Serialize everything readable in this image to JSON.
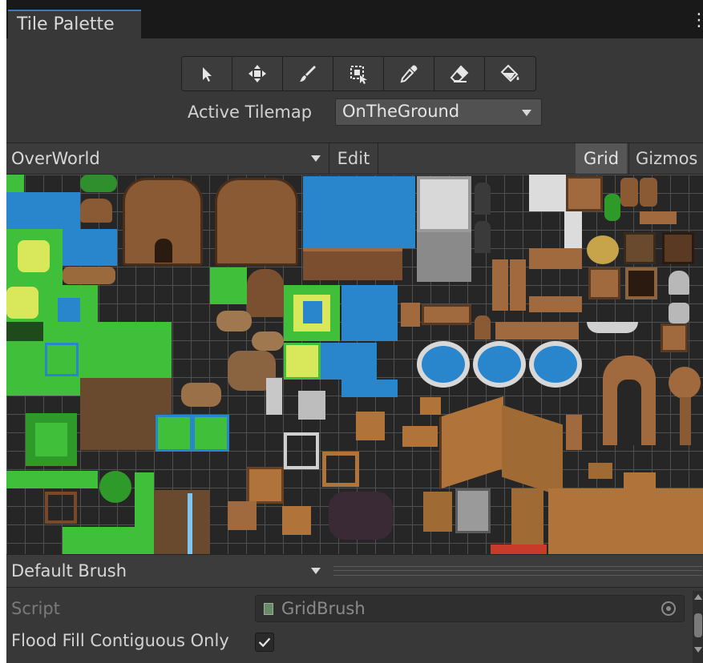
{
  "window": {
    "tab_title": "Tile Palette",
    "menu_icon": "kebab-menu-icon"
  },
  "toolbar": {
    "tools": [
      {
        "name": "select",
        "icon": "arrow-pointer-icon"
      },
      {
        "name": "move",
        "icon": "move-arrows-icon"
      },
      {
        "name": "paint",
        "icon": "brush-icon"
      },
      {
        "name": "box-fill",
        "icon": "box-fill-icon"
      },
      {
        "name": "pick",
        "icon": "eyedropper-icon"
      },
      {
        "name": "erase",
        "icon": "eraser-icon"
      },
      {
        "name": "fill",
        "icon": "paint-bucket-icon"
      }
    ]
  },
  "tilemap": {
    "label": "Active Tilemap",
    "value": "OnTheGround"
  },
  "palette_bar": {
    "palette": "OverWorld",
    "edit": "Edit",
    "grid": "Grid",
    "gizmos": "Gizmos"
  },
  "brush": {
    "name": "Default Brush",
    "script_label": "Script",
    "script_value": "GridBrush",
    "flood_fill_label": "Flood Fill Contiguous Only",
    "flood_fill_checked": true
  },
  "colors": {
    "panel": "#383838",
    "accent": "#3a79bb",
    "grass": "#3fbf3a",
    "water": "#2a86cc",
    "wood": "#8a5a34",
    "stone": "#c8c8c8"
  }
}
